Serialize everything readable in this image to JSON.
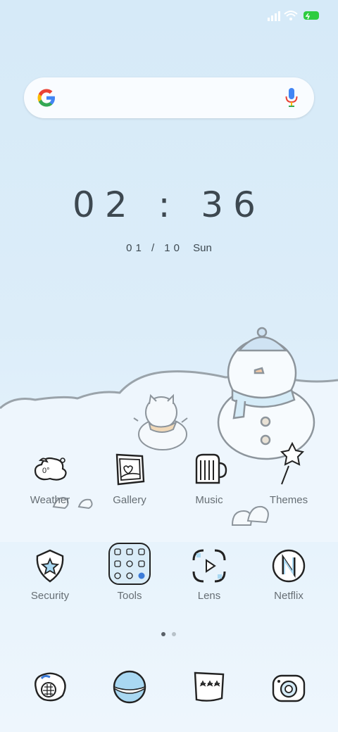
{
  "clock": {
    "time": "02 : 36"
  },
  "date": {
    "day_month": "01 / 10",
    "weekday": "Sun"
  },
  "search": {
    "brand_icon": "google-g-icon",
    "mic_icon": "mic-icon"
  },
  "apps_row1": [
    {
      "label": "Weather",
      "icon": "weather-icon"
    },
    {
      "label": "Gallery",
      "icon": "gallery-icon"
    },
    {
      "label": "Music",
      "icon": "music-icon"
    },
    {
      "label": "Themes",
      "icon": "themes-icon"
    }
  ],
  "apps_row2": [
    {
      "label": "Security",
      "icon": "security-icon"
    },
    {
      "label": "Tools",
      "icon": "tools-icon"
    },
    {
      "label": "Lens",
      "icon": "lens-icon"
    },
    {
      "label": "Netflix",
      "icon": "netflix-icon"
    }
  ],
  "dock": [
    {
      "icon": "phone-icon"
    },
    {
      "icon": "browser-icon"
    },
    {
      "icon": "messages-icon"
    },
    {
      "icon": "camera-icon"
    }
  ],
  "weather_temp": "0°",
  "colors": {
    "text_dark": "#3d4850",
    "label": "#666e74",
    "active_dot": "#5a6168",
    "inactive_dot": "#b8c2c9",
    "battery": "#2ecc40"
  }
}
